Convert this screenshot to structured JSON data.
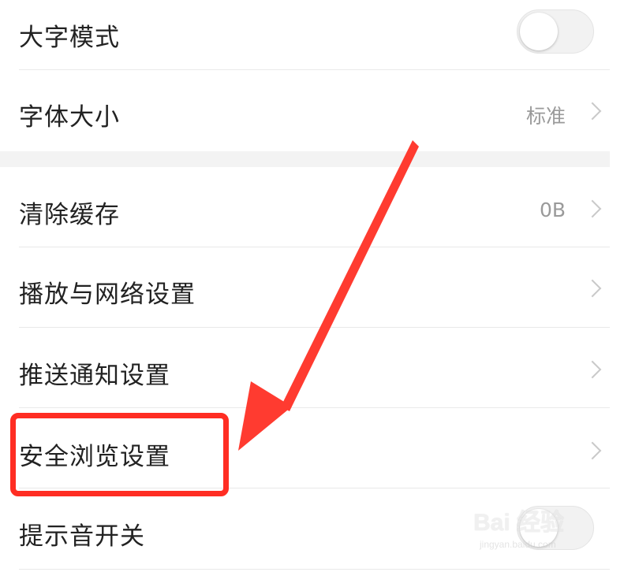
{
  "settings": {
    "large_text_mode": {
      "label": "大字模式",
      "enabled": false
    },
    "font_size": {
      "label": "字体大小",
      "value": "标准"
    },
    "clear_cache": {
      "label": "清除缓存",
      "value": "0B"
    },
    "playback_network": {
      "label": "播放与网络设置"
    },
    "push_notifications": {
      "label": "推送通知设置"
    },
    "safe_browsing": {
      "label": "安全浏览设置"
    },
    "sound_toggle": {
      "label": "提示音开关"
    }
  },
  "annotation": {
    "highlight_color": "#ff2d23",
    "arrow_color": "#ff3b30"
  },
  "watermark": {
    "brand": "Bai 经验",
    "url": "jingyan.baidu.com"
  }
}
